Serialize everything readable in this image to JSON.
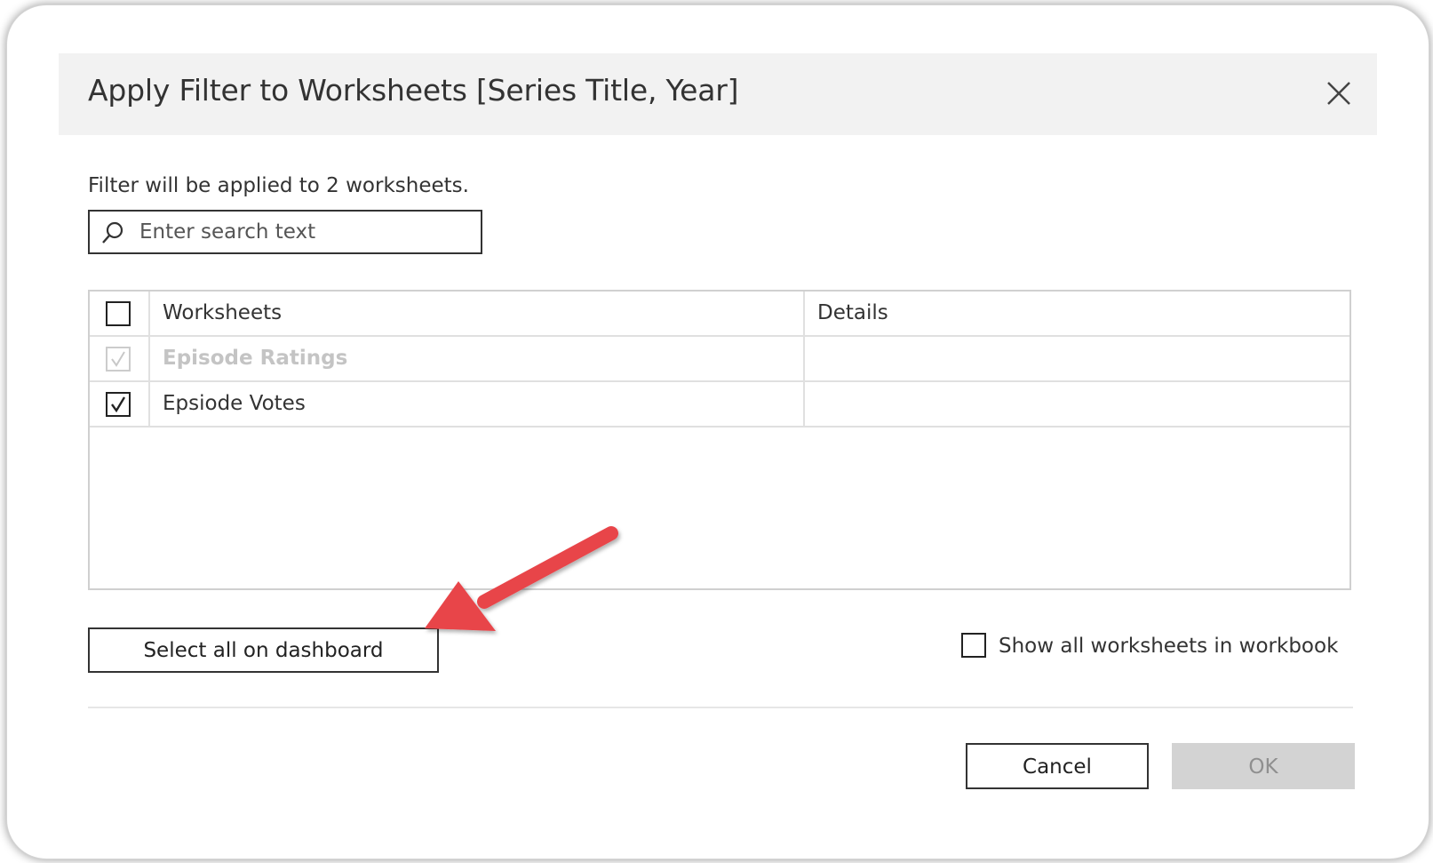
{
  "dialog": {
    "title": "Apply Filter to Worksheets [Series Title, Year]",
    "applied_text": "Filter will be applied to 2 worksheets."
  },
  "search": {
    "placeholder": "Enter search text",
    "value": ""
  },
  "table": {
    "columns": [
      "Worksheets",
      "Details"
    ],
    "rows": [
      {
        "name": "Episode Ratings",
        "details": "",
        "checked": true,
        "disabled": true
      },
      {
        "name": "Epsiode Votes",
        "details": "",
        "checked": true,
        "disabled": false
      }
    ]
  },
  "buttons": {
    "select_all": "Select all on dashboard",
    "cancel": "Cancel",
    "ok": "OK"
  },
  "show_all": {
    "label": "Show all worksheets in workbook",
    "checked": false
  },
  "colors": {
    "title_bar": "#f2f2f2",
    "annotation_arrow": "#e8444a",
    "ok_disabled_bg": "#d3d3d3",
    "disabled_text": "#c4c4c4"
  },
  "icons": {
    "close": "close-icon",
    "search": "search-icon",
    "check": "checkmark-icon",
    "annotation": "annotation-arrow"
  }
}
